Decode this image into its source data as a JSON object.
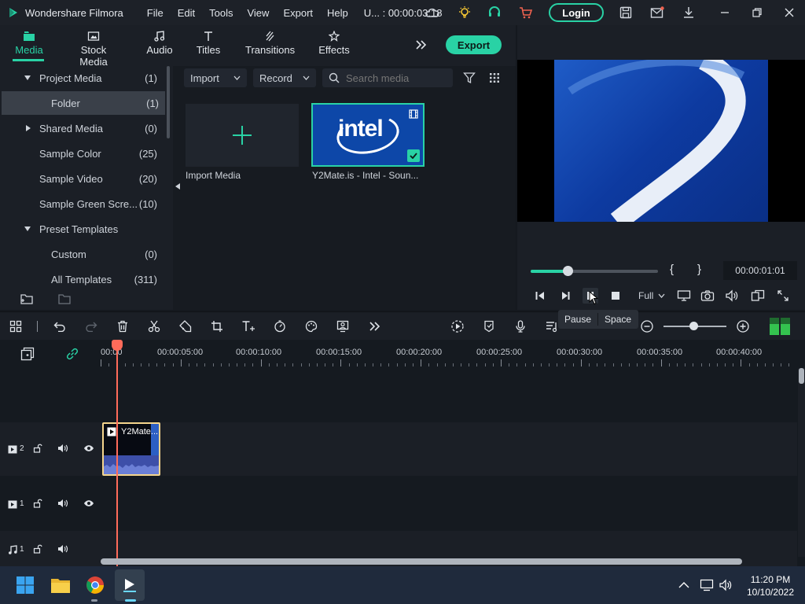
{
  "titlebar": {
    "app_name": "Wondershare Filmora",
    "menu": [
      "File",
      "Edit",
      "Tools",
      "View",
      "Export",
      "Help"
    ],
    "project_title": "U... : 00:00:03:18",
    "login_label": "Login"
  },
  "tabs": [
    {
      "label": "Media",
      "active": true
    },
    {
      "label": "Stock Media"
    },
    {
      "label": "Audio"
    },
    {
      "label": "Titles"
    },
    {
      "label": "Transitions"
    },
    {
      "label": "Effects"
    }
  ],
  "export_label": "Export",
  "tree": [
    {
      "label": "Project Media",
      "count": "(1)"
    },
    {
      "label": "Folder",
      "count": "(1)"
    },
    {
      "label": "Shared Media",
      "count": "(0)"
    },
    {
      "label": "Sample Color",
      "count": "(25)"
    },
    {
      "label": "Sample Video",
      "count": "(20)"
    },
    {
      "label": "Sample Green Scre...",
      "count": "(10)"
    },
    {
      "label": "Preset Templates",
      "count": ""
    },
    {
      "label": "Custom",
      "count": "(0)"
    },
    {
      "label": "All Templates",
      "count": "(311)"
    }
  ],
  "media_toolbar": {
    "import_label": "Import",
    "record_label": "Record",
    "search_placeholder": "Search media"
  },
  "media_items": {
    "import_label": "Import Media",
    "clip_label": "Y2Mate.is - Intel - Soun...",
    "clip_logo_text": "intel"
  },
  "preview": {
    "timecode": "00:00:01:01",
    "progress": 0.29,
    "mark_in": "{",
    "mark_out": "}",
    "quality": "Full"
  },
  "tooltip": {
    "action": "Pause",
    "shortcut": "Space"
  },
  "timeline": {
    "ruler_labels": [
      "00:00",
      "00:00:05:00",
      "00:00:10:00",
      "00:00:15:00",
      "00:00:20:00",
      "00:00:25:00",
      "00:00:30:00",
      "00:00:35:00",
      "00:00:40:00"
    ],
    "tracks": [
      {
        "label": "2",
        "kind": "video"
      },
      {
        "label": "1",
        "kind": "video"
      },
      {
        "label": "1",
        "kind": "audio"
      }
    ],
    "clip_label": "Y2Mate..."
  },
  "taskbar": {
    "time": "11:20 PM",
    "date": "10/10/2022"
  },
  "colors": {
    "accent": "#29d2a5",
    "playhead": "#ff6b5a",
    "clip_border": "#f5d58d"
  }
}
